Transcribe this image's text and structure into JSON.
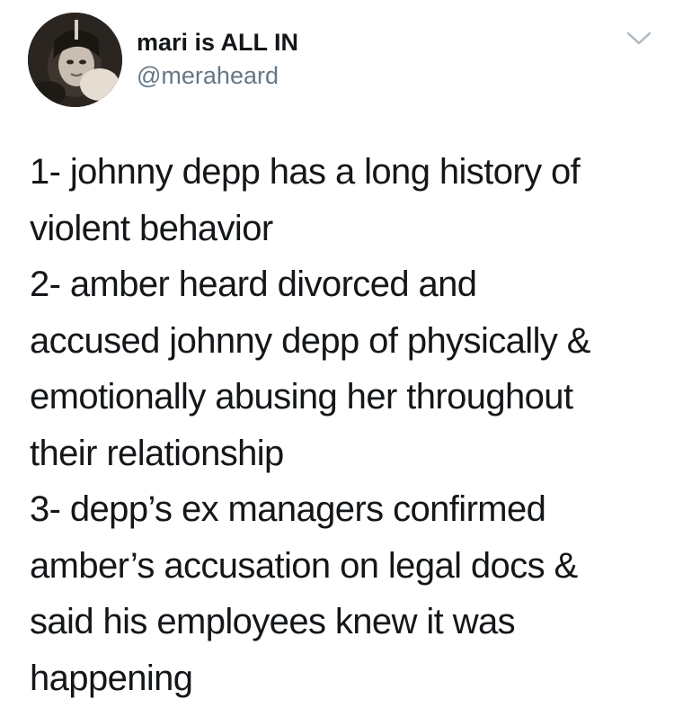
{
  "user": {
    "display_name": "mari is ALL IN",
    "handle": "@meraheard",
    "avatar_icon": "profile-photo"
  },
  "menu": {
    "icon": "chevron-down-icon",
    "color": "#aab8c2"
  },
  "tweet": {
    "lines": [
      "1- johnny depp has a long history of",
      "violent behavior",
      "2- amber heard divorced and",
      "accused johnny depp of physically &",
      "emotionally abusing her throughout",
      "their relationship",
      "3- depp’s ex managers confirmed",
      "amber’s accusation on legal docs &",
      "said his employees knew it was",
      "happening"
    ]
  },
  "colors": {
    "text": "#14171a",
    "secondary": "#657786",
    "background": "#ffffff"
  }
}
